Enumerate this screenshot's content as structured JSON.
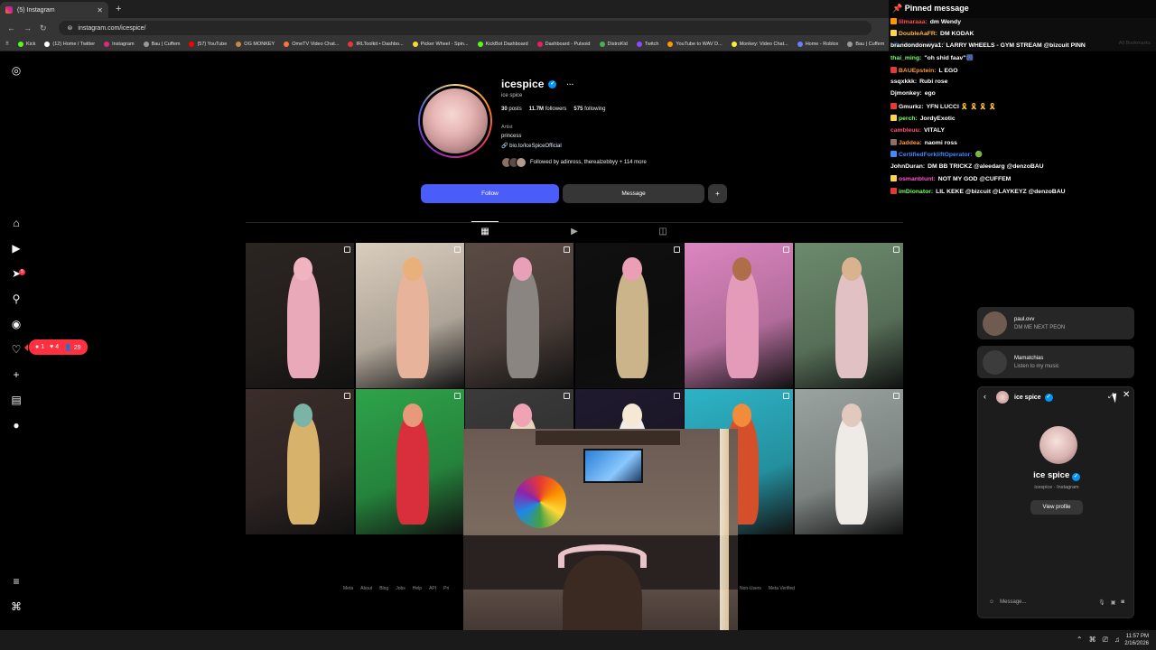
{
  "browser": {
    "tab_title": "(5) Instagram",
    "new_tab_icon": "+",
    "url": "instagram.com/icespice/",
    "bookmarks": [
      {
        "label": "Kick",
        "color": "#53fc18"
      },
      {
        "label": "(12) Home / Twitter",
        "color": "#ffffff"
      },
      {
        "label": "Instagram",
        "color": "#dd2a7b"
      },
      {
        "label": "Bau | Cuffem",
        "color": "#999999"
      },
      {
        "label": "(57) YouTube",
        "color": "#ff0000"
      },
      {
        "label": "OG MONKEY",
        "color": "#c48a4a"
      },
      {
        "label": "OmeTV Video Chat...",
        "color": "#ff7043"
      },
      {
        "label": "IRLToolkit • Dashbo...",
        "color": "#e53935"
      },
      {
        "label": "Picker Wheel - Spin...",
        "color": "#fdd835"
      },
      {
        "label": "KickBot Dashboard",
        "color": "#53fc18"
      },
      {
        "label": "Dashboard - Pulsoid",
        "color": "#e91e63"
      },
      {
        "label": "DistroKid",
        "color": "#4caf50"
      },
      {
        "label": "Twitch",
        "color": "#9146ff"
      },
      {
        "label": "YouTube to WAV D...",
        "color": "#ff9800"
      },
      {
        "label": "Monkey: Video Chat...",
        "color": "#ffeb3b"
      },
      {
        "label": "Home - Roblox",
        "color": "#6b7cff"
      },
      {
        "label": "Bau | Cuffem",
        "color": "#999999"
      },
      {
        "label": "Streamed - Watch A...",
        "color": "#29b6f6"
      }
    ],
    "all_bookmarks": "All Bookmarks"
  },
  "profile": {
    "username": "icespice",
    "verified_glyph": "✓",
    "more_glyph": "···",
    "display_name": "ice spice",
    "posts": "30",
    "posts_label": "posts",
    "followers": "11.7M",
    "followers_label": "followers",
    "following": "575",
    "following_label": "following",
    "category": "Artist",
    "bio": "princess",
    "link": "bio.to/IceSpiceOfficial",
    "followed_by": "Followed by adinross, therealzebbyy + 114 more",
    "follow_button": "Follow",
    "message_button": "Message",
    "add_glyph": "+"
  },
  "activity": {
    "comments": "1",
    "likes": "4",
    "follows": "29",
    "nav_badge": "5"
  },
  "posts": [
    {
      "bg": "#2b2522",
      "fig": "#e9a9b8",
      "head": "#f0b3c0"
    },
    {
      "bg": "#d9cdbd",
      "fig": "#e7b39b",
      "head": "#e9b07c"
    },
    {
      "bg": "#5b4b45",
      "fig": "#8a8580",
      "head": "#e7a0b8"
    },
    {
      "bg": "#101010",
      "fig": "#cbb48a",
      "head": "#ea9fb5"
    },
    {
      "bg": "#dc86c0",
      "fig": "#e49ab9",
      "head": "#b06d4a"
    },
    {
      "bg": "#6c8a6d",
      "fig": "#e1c1c3",
      "head": "#d9b38f"
    },
    {
      "bg": "#3a2d2a",
      "fig": "#d7b26b",
      "head": "#7ab4a6"
    },
    {
      "bg": "#2ea34a",
      "fig": "#d92f3c",
      "head": "#e79a7a"
    },
    {
      "bg": "#3b3b3b",
      "fig": "#e8d5b9",
      "head": "#f0a3b4"
    },
    {
      "bg": "#1f1a2e",
      "fig": "#f1ede8",
      "head": "#f5e8d4"
    },
    {
      "bg": "#2db3c6",
      "fig": "#d5502a",
      "head": "#f08c3a"
    },
    {
      "bg": "#9aa3a0",
      "fig": "#eeeae6",
      "head": "#e3c8bd"
    }
  ],
  "footer": {
    "links": [
      "Meta",
      "About",
      "Blog",
      "Jobs",
      "Help",
      "API",
      "Pri"
    ],
    "links_right": [
      "Non-Users",
      "Meta Verified"
    ]
  },
  "chat": {
    "pinned_title": "Pinned message",
    "messages": [
      {
        "user": "lilmaraaa",
        "text": "dm Wendy",
        "color": "#ff4d4d",
        "badge": "#ff9800"
      },
      {
        "user": "DoubleAaFR",
        "text": "DM KODAK",
        "color": "#ffb347",
        "badge": "#ffd54f"
      },
      {
        "user": "brandondonwya1",
        "text": "LARRY WHEELS - GYM STREAM @bizcuit PINN",
        "color": "#ffffff",
        "badge": ""
      },
      {
        "user": "thai_ming",
        "text": "\"oh shid faav\"🎆",
        "color": "#7cff6b",
        "badge": ""
      },
      {
        "user": "BAUEpstein",
        "text": "L EGO",
        "color": "#ff9a3c",
        "badge": "#e53935"
      },
      {
        "user": "ssqxkkk",
        "text": "Rubi rose",
        "color": "#ffffff",
        "badge": ""
      },
      {
        "user": "Djmonkey",
        "text": "ego",
        "color": "#ffffff",
        "badge": ""
      },
      {
        "user": "Gmurkz",
        "text": "YFN LUCCI 🎗️ 🎗️ 🎗️ 🎗️",
        "color": "#ffffff",
        "badge": "#e53935"
      },
      {
        "user": "perch",
        "text": "JordyExotic",
        "color": "#7cff6b",
        "badge": "#ffd54f"
      },
      {
        "user": "cambleuu",
        "text": "VITALY",
        "color": "#ff4d7a",
        "badge": ""
      },
      {
        "user": "Jaddea",
        "text": "naomi ross",
        "color": "#ff9a3c",
        "badge": "#8d6e63"
      },
      {
        "user": "CertifiedForkliftOperator",
        "text": "🟢",
        "color": "#3d8bff",
        "badge": "#3d8bff"
      },
      {
        "user": "JohnDuran",
        "text": "DM BB TRICKZ @aleedarg @denzoBAU",
        "color": "#ffffff",
        "badge": ""
      },
      {
        "user": "osmanblunt",
        "text": "NOT MY GOD @CUFFEM",
        "color": "#ff5ad1",
        "badge": "#ffd54f"
      },
      {
        "user": "imDionator",
        "text": "LIL KEKE @bizcuit @LAYKEYZ @denzoBAU",
        "color": "#7cff6b",
        "badge": "#e53935"
      }
    ]
  },
  "dm": {
    "threads": [
      {
        "name": "paul.ovv",
        "message": "DM ME NEXT PEON",
        "avatar": "#6f5b4f"
      },
      {
        "name": "Mamatchias",
        "message": "Listen to my music",
        "avatar": "#3c3c3c"
      }
    ],
    "back_glyph": "‹",
    "header_name": "ice spice",
    "expand_glyph": "⤢",
    "close_glyph": "✕",
    "profile_name": "ice spice",
    "profile_sub": "icespice · Instagram",
    "view_profile": "View profile",
    "input_placeholder": "Message...",
    "emoji_glyph": "☺",
    "mic_glyph": "🎙",
    "image_glyph": "▣",
    "sticker_glyph": "◙"
  },
  "taskbar": {
    "time": "11:57 PM",
    "date": "2/16/2026",
    "tray_icons": [
      "⌃",
      "⌘",
      "⎚",
      "♫"
    ]
  }
}
